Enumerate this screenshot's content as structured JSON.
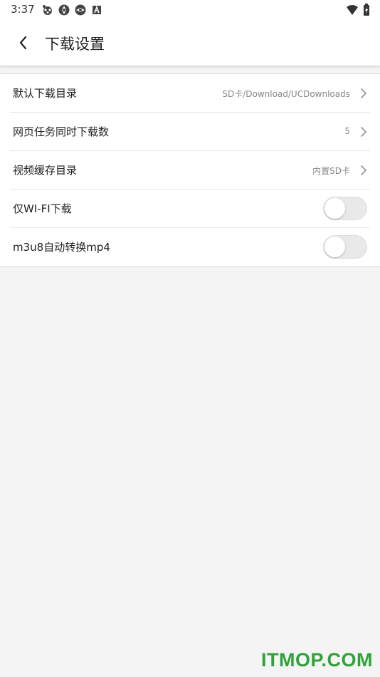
{
  "status_bar": {
    "time": "3:37",
    "icons_left": [
      "paw-notification-icon",
      "aperture-notification-icon",
      "aperture-notification-icon",
      "a-box-notification-icon"
    ],
    "icons_right": [
      "wifi-icon",
      "battery-charging-icon"
    ]
  },
  "app_bar": {
    "back_icon": "chevron-left-icon",
    "title": "下载设置"
  },
  "settings": {
    "default_dir": {
      "label": "默认下载目录",
      "value": "SD卡/Download/UCDownloads"
    },
    "concurrent": {
      "label": "网页任务同时下载数",
      "value": "5"
    },
    "video_cache": {
      "label": "视频缓存目录",
      "value": "内置SD卡"
    },
    "wifi_only": {
      "label": "仅WI-FI下载",
      "enabled": false
    },
    "m3u8": {
      "label": "m3u8自动转换mp4",
      "enabled": false
    }
  },
  "watermark": "ITMOP.COM",
  "colors": {
    "background": "#f4f4f4",
    "surface": "#ffffff",
    "text_primary": "#222222",
    "text_secondary": "#888888",
    "toggle_off": "#e9e9e9",
    "watermark": "#2fa33a"
  }
}
